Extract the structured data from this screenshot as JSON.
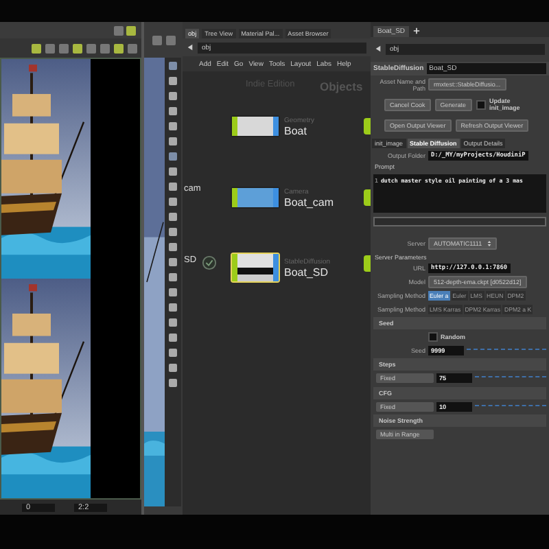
{
  "viewer": {
    "frame": "0",
    "zoom": "2:2"
  },
  "network": {
    "tabs": [
      {
        "label": "obj",
        "selected": true
      },
      {
        "label": "Tree View",
        "selected": false
      },
      {
        "label": "Material Pal...",
        "selected": false
      },
      {
        "label": "Asset Browser",
        "selected": false
      }
    ],
    "path": "obj",
    "menu": [
      "Add",
      "Edit",
      "Go",
      "View",
      "Tools",
      "Layout",
      "Labs",
      "Help"
    ],
    "edition": "Indie Edition",
    "context": "Objects",
    "clipped_labels": [
      "cam",
      "SD"
    ],
    "nodes": [
      {
        "type": "Geometry",
        "name": "Boat",
        "kind": "geometry",
        "selected": false
      },
      {
        "type": "Camera",
        "name": "Boat_cam",
        "kind": "camera",
        "selected": false
      },
      {
        "type": "StableDiffusion",
        "name": "Boat_SD",
        "kind": "stablediffusion",
        "selected": true
      }
    ]
  },
  "parameters": {
    "tab": "Boat_SD",
    "path": "obj",
    "node_type": "StableDiffusion",
    "node_name": "Boat_SD",
    "asset_label": "Asset Name and Path",
    "asset_value": "rmxtest::StableDiffusio...",
    "buttons": [
      "Cancel Cook",
      "Generate"
    ],
    "update_checkbox": {
      "label": "Update init_image",
      "checked": false
    },
    "viewer_buttons": [
      "Open Output Viewer",
      "Refresh Output Viewer"
    ],
    "tabs": [
      {
        "label": "init_image",
        "selected": false
      },
      {
        "label": "Stable Diffusion",
        "selected": true
      },
      {
        "label": "Output Details",
        "selected": false
      }
    ],
    "output_folder": {
      "label": "Output Folder",
      "value": "D:/_MY/myProjects/HoudiniP"
    },
    "prompt": {
      "label": "Prompt",
      "line": "1",
      "value": "dutch master style oil painting of a 3 mas"
    },
    "server": {
      "label": "Server",
      "value": "AUTOMATIC1111"
    },
    "server_parameters": "Server Parameters",
    "url": {
      "label": "URL",
      "value": "http://127.0.0.1:7860"
    },
    "model": {
      "label": "Model",
      "value": "512-depth-ema.ckpt [d0522d12]"
    },
    "sampling_rows": [
      {
        "label": "Sampling Method",
        "options": [
          {
            "label": "Euler a",
            "selected": true
          },
          {
            "label": "Euler",
            "selected": false
          },
          {
            "label": "LMS",
            "selected": false
          },
          {
            "label": "HEUN",
            "selected": false
          },
          {
            "label": "DPM2",
            "selected": false
          }
        ]
      },
      {
        "label": "Sampling Method",
        "options": [
          {
            "label": "LMS Karras",
            "selected": false
          },
          {
            "label": "DPM2 Karras",
            "selected": false
          },
          {
            "label": "DPM2 a K",
            "selected": false
          }
        ]
      }
    ],
    "seed": {
      "title": "Seed",
      "random": {
        "label": "Random",
        "checked": false
      },
      "label": "Seed",
      "value": "9999"
    },
    "steps": {
      "title": "Steps",
      "mode": "Fixed",
      "value": "75"
    },
    "cfg": {
      "title": "CFG",
      "mode": "Fixed",
      "value": "10"
    },
    "noise": {
      "title": "Noise Strength",
      "mode": "Multi in Range"
    }
  }
}
